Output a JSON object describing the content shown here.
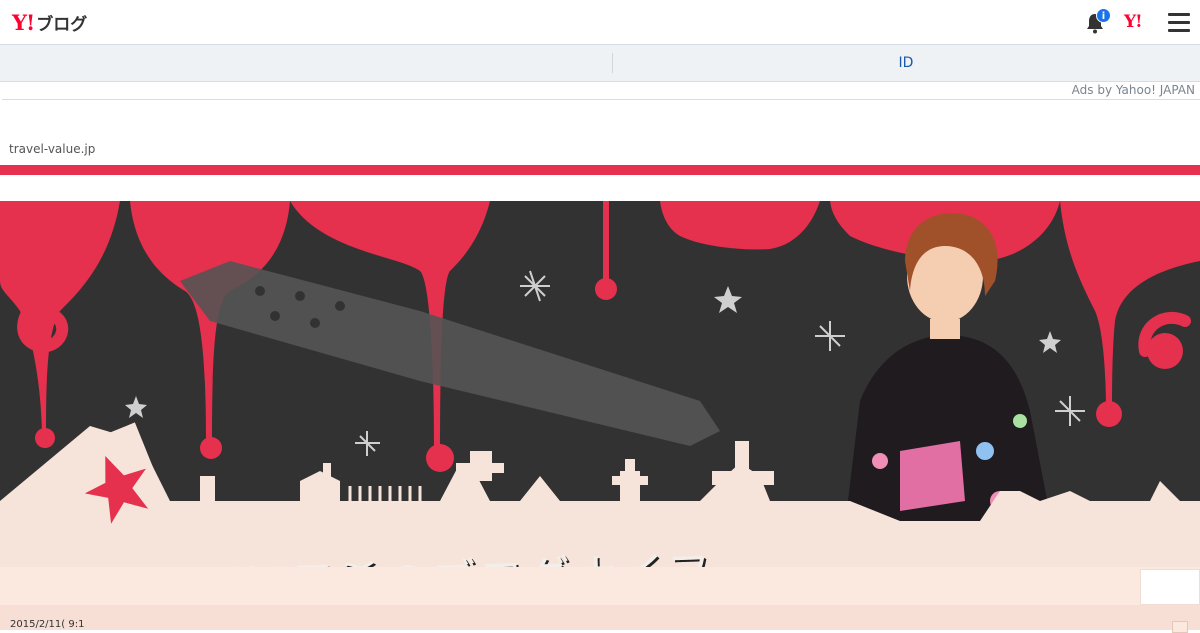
{
  "header": {
    "logo_mark": "Y!",
    "logo_text": "ブログ",
    "notification_count": "i",
    "yj_mark": "Y!",
    "icons": [
      "bell-icon",
      "yahoo-japan-icon",
      "menu-icon"
    ]
  },
  "idbar": {
    "id_label": "ID"
  },
  "ads": {
    "label": "Ads by Yahoo! JAPAN",
    "site": "travel-value.jp"
  },
  "banner": {
    "title": "桜稲垣早希のブログナイフ"
  },
  "post": {
    "date": "2015/2/11(  9:1"
  },
  "colors": {
    "accent": "#e5304e",
    "yahoo_red": "#ff0033",
    "link": "#1a5aa8",
    "banner_bg": "#333232",
    "skyline": "#f6e4da"
  }
}
